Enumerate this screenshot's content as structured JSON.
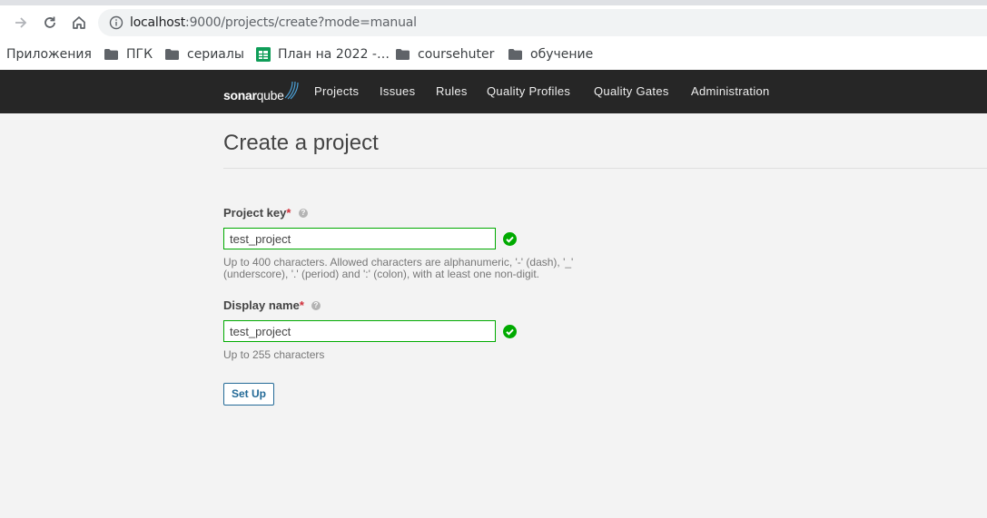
{
  "browser": {
    "url_host": "localhost",
    "url_rest": ":9000/projects/create?mode=manual",
    "bookmarks": [
      {
        "label": "Приложения",
        "icon": "apps-grid-icon"
      },
      {
        "label": "ПГК",
        "icon": "folder-icon"
      },
      {
        "label": "сериалы",
        "icon": "folder-icon"
      },
      {
        "label": "План на 2022 -…",
        "icon": "google-sheets-icon"
      },
      {
        "label": "coursehuter",
        "icon": "folder-icon"
      },
      {
        "label": "обучение",
        "icon": "folder-icon"
      }
    ]
  },
  "navbar": {
    "logo_bold": "sonar",
    "logo_light": "qube",
    "items": [
      "Projects",
      "Issues",
      "Rules",
      "Quality Profiles",
      "Quality Gates",
      "Administration"
    ]
  },
  "page": {
    "title": "Create a project",
    "project_key": {
      "label": "Project key",
      "required_mark": "*",
      "help_glyph": "?",
      "value": "test_project",
      "help_line1": "Up to 400 characters. Allowed characters are alphanumeric, '-' (dash), '_'",
      "help_line2": "(underscore), '.' (period) and ':' (colon), with at least one non-digit."
    },
    "display_name": {
      "label": "Display name",
      "required_mark": "*",
      "help_glyph": "?",
      "value": "test_project",
      "help": "Up to 255 characters"
    },
    "submit_label": "Set Up"
  },
  "colors": {
    "navbar_bg": "#262626",
    "page_bg": "#f3f3f3",
    "valid_green": "#00aa00",
    "primary_blue": "#236a97",
    "required_red": "#d02f3a"
  }
}
